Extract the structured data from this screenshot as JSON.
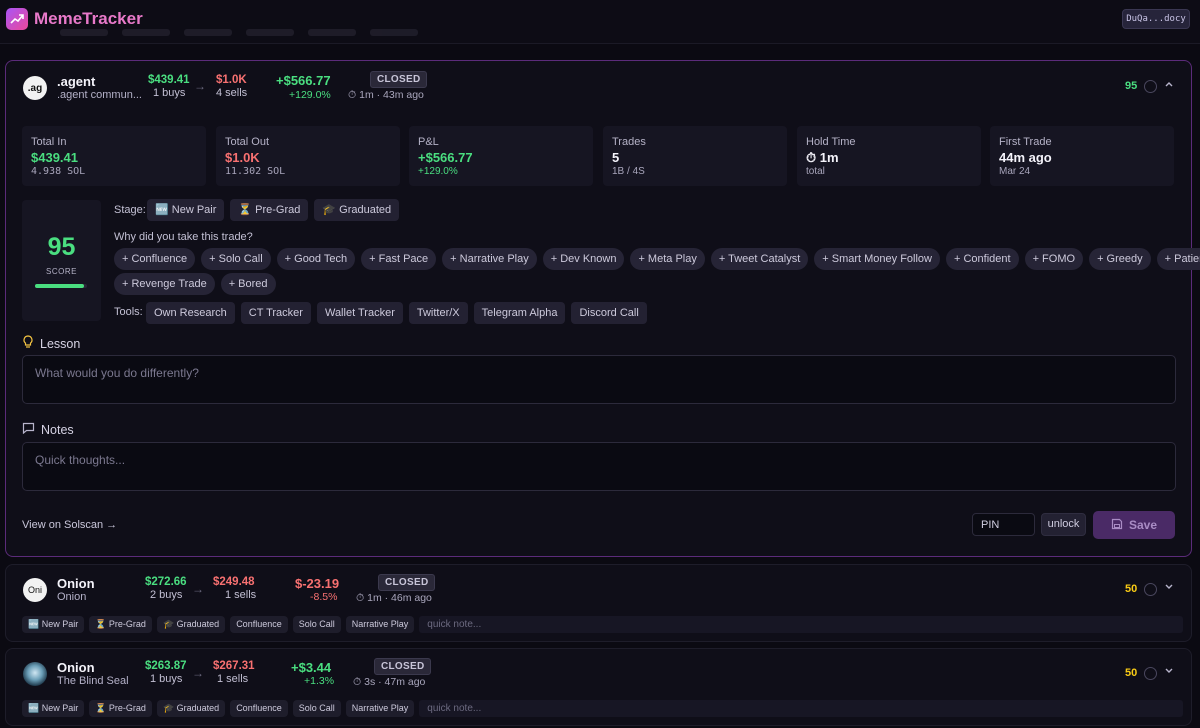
{
  "app": {
    "title": "MemeTracker",
    "wallet": "DuQa...docy"
  },
  "main_card": {
    "avatar": ".ag",
    "name": ".agent",
    "subtitle": ".agent commun...",
    "in_amount": "$439.41",
    "in_count": "1 buys",
    "arrow": "→",
    "out_amount": "$1.0K",
    "out_count": "4 sells",
    "pnl": "+$566.77",
    "pnl_pct": "+129.0%",
    "status": "CLOSED",
    "hold_info": "⏱ 1m · 43m ago",
    "score_right": "95",
    "stats": [
      {
        "label": "Total In",
        "value": "$439.41",
        "sub": "4.938 SOL",
        "color": "#4ade80"
      },
      {
        "label": "Total Out",
        "value": "$1.0K",
        "sub": "11.302 SOL",
        "color": "#f87171"
      },
      {
        "label": "P&L",
        "value": "+$566.77",
        "sub": "+129.0%",
        "color": "#4ade80"
      },
      {
        "label": "Trades",
        "value": "5",
        "sub": "1B / 4S",
        "color": "#f4f3fa"
      },
      {
        "label": "Hold Time",
        "value": "⏱ 1m",
        "sub": "total",
        "color": "#f4f3fa"
      },
      {
        "label": "First Trade",
        "value": "44m ago",
        "sub": "Mar 24",
        "color": "#f4f3fa"
      }
    ],
    "score": "95",
    "score_label": "SCORE",
    "score_fill": 0.95,
    "stage_label": "Stage:",
    "stages": [
      "🆕 New Pair",
      "⏳ Pre-Grad",
      "🎓 Graduated"
    ],
    "why_label": "Why did you take this trade?",
    "reasons_row1": [
      "+ Confluence",
      "+ Solo Call",
      "+ Good Tech",
      "+ Fast Pace",
      "+ Narrative Play",
      "+ Dev Known",
      "+ Meta Play",
      "+ Tweet Catalyst",
      "+ Smart Money Follow",
      "+ Confident",
      "+ FOMO",
      "+ Greedy",
      "+ Patient"
    ],
    "reasons_row2": [
      "+ Revenge Trade",
      "+ Bored"
    ],
    "tools_label": "Tools:",
    "tools": [
      "Own Research",
      "CT Tracker",
      "Wallet Tracker",
      "Twitter/X",
      "Telegram Alpha",
      "Discord Call"
    ],
    "lesson_title": "Lesson",
    "lesson_placeholder": "What would you do differently?",
    "notes_title": "Notes",
    "notes_placeholder": "Quick thoughts...",
    "solscan": "View on Solscan →",
    "pin_placeholder": "PIN",
    "unlock": "unlock",
    "save": "Save"
  },
  "cards": [
    {
      "avatar": "Oni",
      "name": "Onion",
      "subtitle": "Onion",
      "in_amount": "$272.66",
      "in_count": "2 buys",
      "out_amount": "$249.48",
      "out_count": "1 sells",
      "pnl": "$-23.19",
      "pnl_pct": "-8.5%",
      "status": "CLOSED",
      "hold_info": "⏱ 1m · 46m ago",
      "score": "50",
      "tags": [
        "🆕 New Pair",
        "⏳ Pre-Grad",
        "🎓 Graduated",
        "Confluence",
        "Solo Call",
        "Narrative Play"
      ],
      "note_placeholder": "quick note..."
    },
    {
      "avatar": "",
      "name": "Onion",
      "subtitle": "The Blind Seal",
      "in_amount": "$263.87",
      "in_count": "1 buys",
      "out_amount": "$267.31",
      "out_count": "1 sells",
      "pnl": "+$3.44",
      "pnl_pct": "+1.3%",
      "status": "CLOSED",
      "hold_info": "⏱ 3s · 47m ago",
      "score": "50",
      "tags": [
        "🆕 New Pair",
        "⏳ Pre-Grad",
        "🎓 Graduated",
        "Confluence",
        "Solo Call",
        "Narrative Play"
      ],
      "note_placeholder": "quick note..."
    }
  ]
}
